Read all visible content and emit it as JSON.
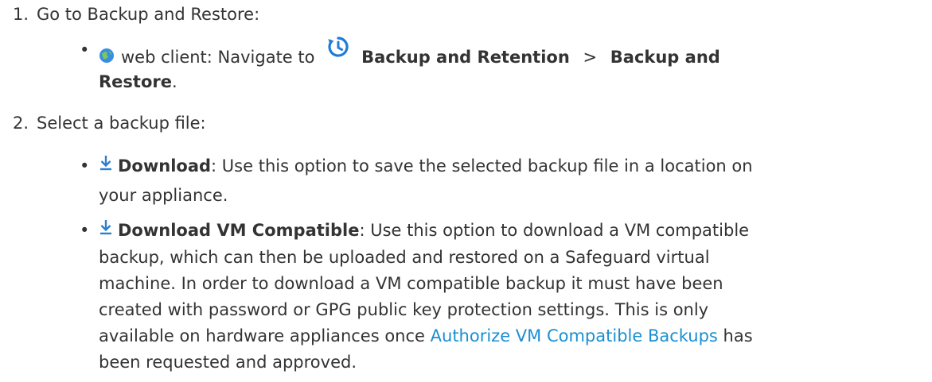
{
  "steps": [
    {
      "number": "1.",
      "text": "Go to Backup and Restore:",
      "bullets": [
        {
          "client_label": "web client: Navigate to",
          "menu_path_1": "Backup and Retention",
          "separator": ">",
          "menu_path_2_a": "Backup and",
          "menu_path_2_b": "Restore",
          "suffix": ".",
          "icons": [
            "web-client-globe-icon",
            "backup-retention-clock-icon"
          ]
        }
      ]
    },
    {
      "number": "2.",
      "text": "Select a backup file:",
      "bullets": [
        {
          "title": "Download",
          "description_line1": ": Use this option to save the selected backup file in a location on",
          "description_line2": "your appliance.",
          "icon": "download-arrow-icon"
        },
        {
          "title": "Download VM Compatible",
          "description_line1": ": Use this option to download a VM compatible",
          "description_line2": "backup, which can then be uploaded and restored on a Safeguard virtual",
          "description_line3": "machine. In order to download a VM compatible backup it must have been",
          "description_line4": "created with password or GPG public key protection settings. This is only",
          "description_line5_before_link": "available on hardware appliances once ",
          "link_text": "Authorize VM Compatible Backups",
          "description_line5_after_link": " has",
          "description_line6": "been requested and approved.",
          "icon": "download-arrow-icon"
        }
      ]
    }
  ],
  "colors": {
    "text": "#333333",
    "link": "#1a8fd1",
    "icon_blue": "#1e7bd8",
    "icon_download": "#2a7fcf"
  }
}
